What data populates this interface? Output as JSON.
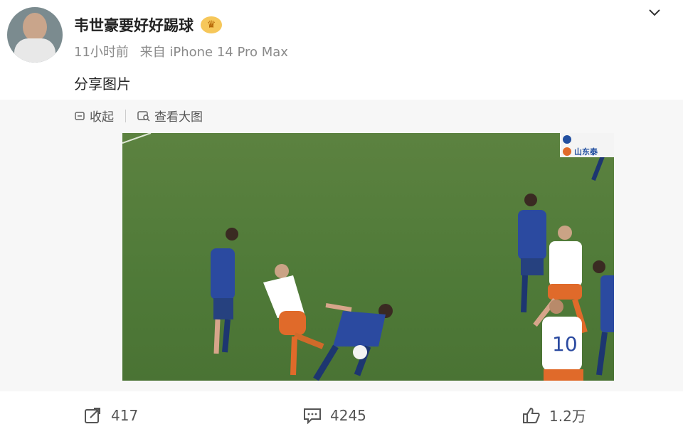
{
  "post": {
    "username": "韦世豪要好好踢球",
    "time": "11小时前",
    "source": "来自 iPhone 14 Pro Max",
    "text": "分享图片"
  },
  "media_actions": {
    "collapse": "收起",
    "view_large": "查看大图"
  },
  "photo": {
    "scorebug_line2": "山东泰"
  },
  "footer": {
    "repost_count": "417",
    "comment_count": "4245",
    "like_count": "1.2万"
  },
  "colors": {
    "pitch": "#4f7a38",
    "home_kit": "#2b4aa0",
    "away_kit": "#ffffff",
    "away_shorts": "#e06a2a",
    "verified_badge": "#f5b800"
  }
}
